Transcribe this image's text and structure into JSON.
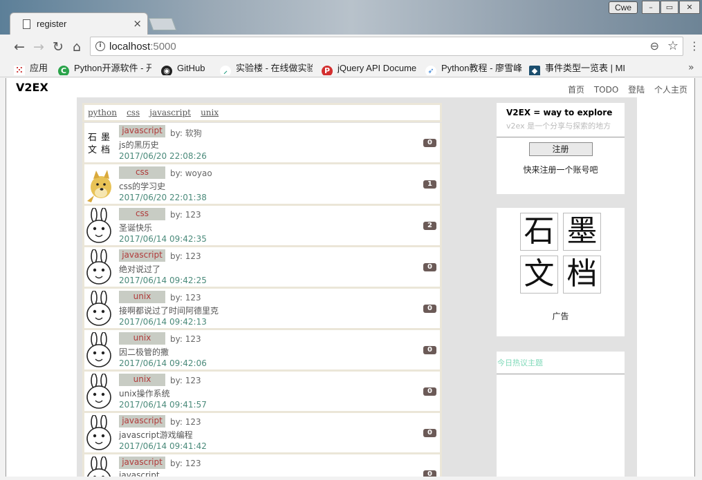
{
  "browser": {
    "tab_title": "register",
    "user_badge": "Cwe",
    "url_host": "localhost",
    "url_port": ":5000",
    "bookmarks": [
      "应用",
      "Python开源软件 - 开",
      "GitHub",
      "实验楼 - 在线做实验",
      "jQuery API Docume",
      "Python教程 - 廖雪峰",
      "事件类型一览表 | MI"
    ]
  },
  "site": {
    "logo": "V2EX",
    "nav": [
      "首页",
      "TODO",
      "登陆",
      "个人主页"
    ]
  },
  "nodes": [
    "python",
    "css",
    "javascript",
    "unix"
  ],
  "topics": [
    {
      "tag": "javascript",
      "author": "by: 软狗",
      "title": "js的黑历史",
      "time": "2017/06/20 22:08:26",
      "replies": "0",
      "avatar": "stone"
    },
    {
      "tag": "css",
      "author": "by: woyao",
      "title": "css的学习史",
      "time": "2017/06/20 22:01:38",
      "replies": "1",
      "avatar": "doge"
    },
    {
      "tag": "css",
      "author": "by: 123",
      "title": "圣诞快乐",
      "time": "2017/06/14 09:42:35",
      "replies": "2",
      "avatar": "rabbit"
    },
    {
      "tag": "javascript",
      "author": "by: 123",
      "title": "绝对说过了",
      "time": "2017/06/14 09:42:25",
      "replies": "0",
      "avatar": "rabbit"
    },
    {
      "tag": "unix",
      "author": "by: 123",
      "title": "接啊都说过了时间阿德里克",
      "time": "2017/06/14 09:42:13",
      "replies": "0",
      "avatar": "rabbit"
    },
    {
      "tag": "unix",
      "author": "by: 123",
      "title": "因二极管的撒",
      "time": "2017/06/14 09:42:06",
      "replies": "0",
      "avatar": "rabbit"
    },
    {
      "tag": "unix",
      "author": "by: 123",
      "title": "unix操作系统",
      "time": "2017/06/14 09:41:57",
      "replies": "0",
      "avatar": "rabbit"
    },
    {
      "tag": "javascript",
      "author": "by: 123",
      "title": "javascript游戏编程",
      "time": "2017/06/14 09:41:42",
      "replies": "0",
      "avatar": "rabbit"
    },
    {
      "tag": "javascript",
      "author": "by: 123",
      "title": "javascript",
      "time": "",
      "replies": "0",
      "avatar": "rabbit"
    }
  ],
  "sidebar": {
    "title": "V2EX = way to explore",
    "subtitle": "v2ex 是一个分享与探索的地方",
    "register_label": "注册",
    "register_hint": "快来注册一个账号吧",
    "ad_chars": [
      "石",
      "墨",
      "文",
      "档"
    ],
    "ad_label": "广告",
    "hot_title": "今日热议主题"
  }
}
